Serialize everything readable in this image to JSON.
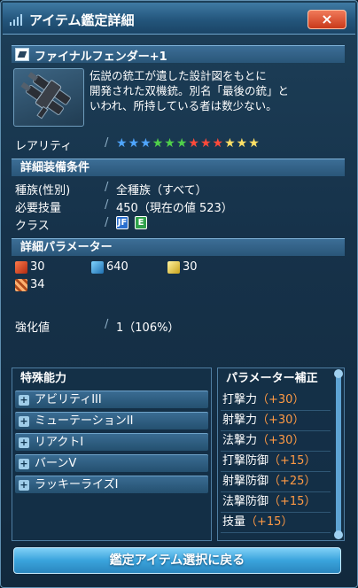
{
  "window": {
    "title": "アイテム鑑定詳細",
    "close_label": "×"
  },
  "item": {
    "name": "ファイナルフェンダー+1",
    "description": [
      "伝説の銃工が遺した設計図をもとに",
      "開発された双機銃。別名「最後の銃」と",
      "いわれ、所持している者は数少ない。"
    ]
  },
  "rarity": {
    "label": "レアリティ",
    "stars": [
      {
        "color": "#4fa6ff"
      },
      {
        "color": "#4fa6ff"
      },
      {
        "color": "#4fa6ff"
      },
      {
        "color": "#4fd04a"
      },
      {
        "color": "#4fd04a"
      },
      {
        "color": "#4fd04a"
      },
      {
        "color": "#ff4a3a"
      },
      {
        "color": "#ff4a3a"
      },
      {
        "color": "#ff4a3a"
      },
      {
        "color": "#ffe066"
      },
      {
        "color": "#ffe066"
      },
      {
        "color": "#ffe066"
      }
    ]
  },
  "equip_conditions": {
    "header": "詳細装備条件",
    "race_label": "種族(性別)",
    "race_value": "全種族（すべて）",
    "skill_label": "必要技量",
    "skill_value": "450（現在の値 523）",
    "class_label": "クラス",
    "class_icons": [
      {
        "name": "gunner-class-icon",
        "glyph": "JF",
        "color": "#2a6fcf"
      },
      {
        "name": "ranger-class-icon",
        "glyph": "E",
        "color": "#2fa04a"
      }
    ]
  },
  "parameters": {
    "header": "詳細パラメーター",
    "striking_attack": "30",
    "ranged_attack": "640",
    "technique_attack": "30",
    "element_value": "34",
    "grind_label": "強化値",
    "grind_value": "1（106%）"
  },
  "special_abilities": {
    "title": "特殊能力",
    "items": [
      "アビリティIII",
      "ミューテーションII",
      "リアクトI",
      "バーンV",
      "ラッキーライズI"
    ]
  },
  "parameter_bonus": {
    "title": "パラメーター補正",
    "rows": [
      {
        "label": "打撃力",
        "value": "（+30）"
      },
      {
        "label": "射撃力",
        "value": "（+30）"
      },
      {
        "label": "法撃力",
        "value": "（+30）"
      },
      {
        "label": "打撃防御",
        "value": "（+15）"
      },
      {
        "label": "射撃防御",
        "value": "（+25）"
      },
      {
        "label": "法撃防御",
        "value": "（+15）"
      },
      {
        "label": "技量",
        "value": "（+15）"
      }
    ]
  },
  "footer": {
    "back_button": "鑑定アイテム選択に戻る"
  },
  "colors": {
    "accent": "#3aa3dc",
    "bonus": "#ff9a45",
    "close": "#c9391a"
  }
}
